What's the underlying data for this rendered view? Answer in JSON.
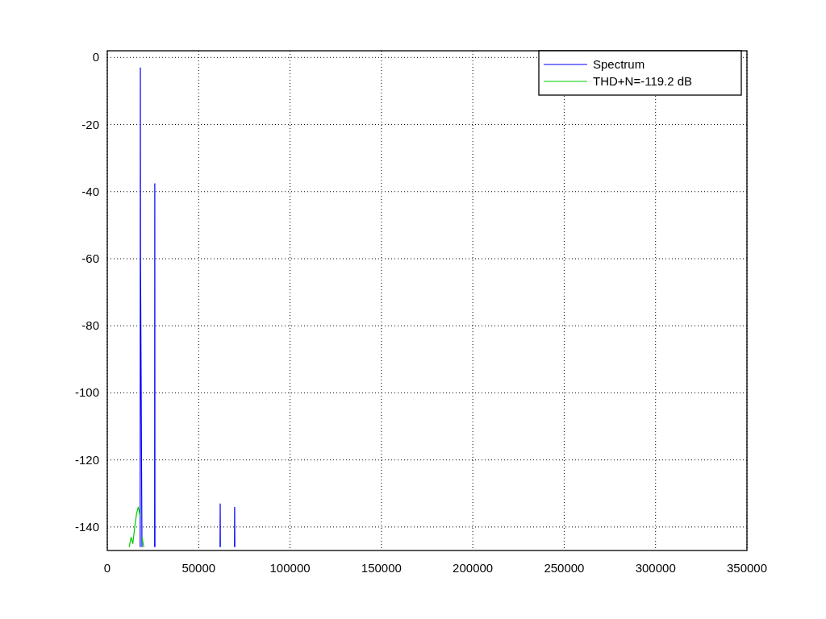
{
  "chart_data": {
    "type": "line",
    "x": [
      12000,
      13000,
      14000,
      15000,
      16000,
      17000,
      18000,
      18100,
      18200,
      19000,
      20000,
      25900,
      26000,
      26100,
      61700,
      61800,
      61900,
      69600,
      69700,
      69800
    ],
    "series": [
      {
        "name": "Spectrum",
        "color": "#0000ff",
        "values": [
          null,
          null,
          null,
          null,
          null,
          null,
          -146,
          -3,
          -60,
          -146,
          null,
          -146,
          -37.5,
          -146,
          -146,
          -133,
          -146,
          -146,
          -134,
          -146
        ]
      },
      {
        "name": "THD+N=-119.2 dB",
        "color": "#00cc00",
        "values": [
          -146,
          -143,
          -145,
          -140,
          -136,
          -134,
          -137,
          null,
          null,
          -143,
          -146,
          null,
          null,
          null,
          null,
          null,
          null,
          null,
          null,
          null
        ]
      }
    ],
    "xlim": [
      0,
      350000
    ],
    "ylim": [
      -147,
      2
    ],
    "xticks": [
      0,
      50000,
      100000,
      150000,
      200000,
      250000,
      300000,
      350000
    ],
    "yticks": [
      -140,
      -120,
      -100,
      -80,
      -60,
      -40,
      -20,
      0
    ],
    "grid": true,
    "legend": true
  }
}
